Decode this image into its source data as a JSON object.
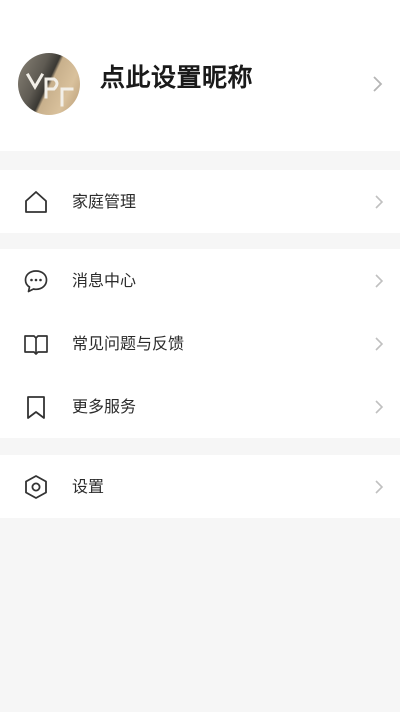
{
  "profile": {
    "nickname": "点此设置昵称",
    "avatar_icon": "avatar-image",
    "chevron_icon": "chevron-right-icon"
  },
  "menu": {
    "home_management": {
      "label": "家庭管理",
      "icon": "house-icon"
    },
    "messages": {
      "label": "消息中心",
      "icon": "chat-bubble-icon"
    },
    "faq_feedback": {
      "label": "常见问题与反馈",
      "icon": "open-book-icon"
    },
    "more_services": {
      "label": "更多服务",
      "icon": "bookmark-icon"
    },
    "settings": {
      "label": "设置",
      "icon": "hexagon-settings-icon"
    }
  },
  "colors": {
    "background": "#f6f6f6",
    "card": "#ffffff",
    "text_primary": "#1a1a1a",
    "text_item": "#2b2b2b",
    "chevron": "#b5b5b5"
  }
}
